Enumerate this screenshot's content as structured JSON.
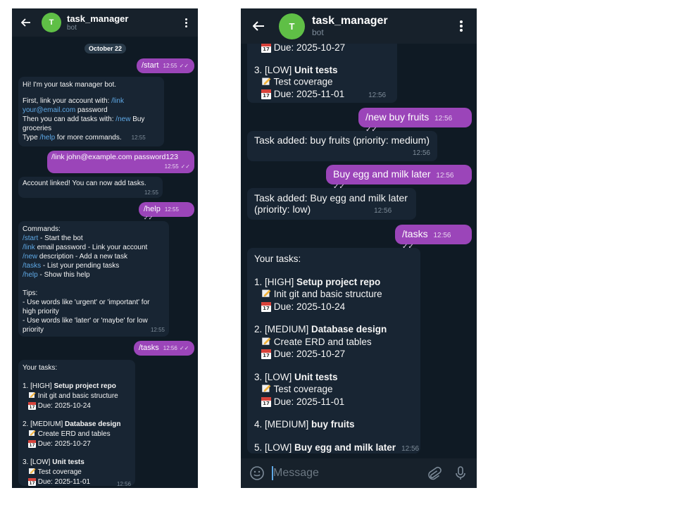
{
  "chat": {
    "title": "task_manager",
    "subtitle": "bot",
    "avatar_letter": "T",
    "date_pill": "October 22",
    "input_placeholder": "Message"
  },
  "messages": {
    "start": {
      "text": "/start",
      "time": "12:55"
    },
    "welcome": {
      "l1": "Hi! I'm your task manager bot.",
      "l2a": "First, link your account with: ",
      "l2b": "/link",
      "l3a": "your@email.com",
      "l3b": " password",
      "l4a": "Then you can add tasks with: ",
      "l4b": "/new",
      "l4c": " Buy",
      "l5": "groceries",
      "l6a": "Type ",
      "l6b": "/help",
      "l6c": " for more commands.",
      "time": "12:55"
    },
    "link": {
      "text": "/link john@example.com password123",
      "time": "12:55"
    },
    "linked": {
      "text": "Account linked! You can now add tasks.",
      "time": "12:55"
    },
    "help": {
      "text": "/help",
      "time": "12:55"
    },
    "commands": {
      "head": "Commands:",
      "c1a": "/start",
      "c1b": " - Start the bot",
      "c2a": "/link",
      "c2b": " email password - Link your account",
      "c3a": "/new",
      "c3b": " description - Add a new task",
      "c4a": "/tasks",
      "c4b": " - List your pending tasks",
      "c5a": "/help",
      "c5b": " - Show this help",
      "tips": "Tips:",
      "t1": "- Use words like 'urgent' or 'important' for",
      "t2": "high priority",
      "t3": "- Use words like 'later' or 'maybe' for low",
      "t4": "priority",
      "time": "12:55"
    },
    "tasks_cmd1": {
      "text": "/tasks",
      "time": "12:56"
    },
    "tasks_list1": {
      "head": "Your tasks:",
      "i1a": "1. [HIGH] ",
      "i1b": "Setup project repo",
      "i1c": "Init git and basic structure",
      "i1d": "Due: 2025-10-24",
      "i2a": "2. [MEDIUM] ",
      "i2b": "Database design",
      "i2c": "Create ERD and tables",
      "i2d": "Due: 2025-10-27",
      "i3a": "3. [LOW] ",
      "i3b": "Unit tests",
      "i3c": "Test coverage",
      "i3d": "Due: 2025-11-01",
      "time": "12:56"
    },
    "partial": {
      "due": "Due: 2025-10-27",
      "i3a": "3. [LOW] ",
      "i3b": "Unit tests",
      "i3c": "Test coverage",
      "i3d": "Due: 2025-11-01",
      "time": "12:56"
    },
    "new_fruits": {
      "text": "/new buy fruits",
      "time": "12:56"
    },
    "added_fruits": {
      "text": "Task added: buy fruits (priority: medium)",
      "time": "12:56"
    },
    "egg": {
      "text": "Buy egg and milk later",
      "time": "12:56"
    },
    "added_egg": {
      "l1": "Task added: Buy egg and milk later",
      "l2": "(priority: low)",
      "time": "12:56"
    },
    "tasks_cmd2": {
      "text": "/tasks",
      "time": "12:56"
    },
    "tasks_list2": {
      "head": "Your tasks:",
      "i1a": "1. [HIGH] ",
      "i1b": "Setup project repo",
      "i1c": "Init git and basic structure",
      "i1d": "Due: 2025-10-24",
      "i2a": "2. [MEDIUM] ",
      "i2b": "Database design",
      "i2c": "Create ERD and tables",
      "i2d": "Due: 2025-10-27",
      "i3a": "3. [LOW] ",
      "i3b": "Unit tests",
      "i3c": "Test coverage",
      "i3d": "Due: 2025-11-01",
      "i4a": "4. [MEDIUM] ",
      "i4b": "buy fruits",
      "i5a": "5. [LOW] ",
      "i5b": "Buy egg and milk later",
      "time": "12:56"
    }
  },
  "calendar_day": "17",
  "icons": [
    "back-arrow-icon",
    "more-vert-icon",
    "double-check-icon",
    "pencil-memo-icon",
    "calendar-icon",
    "emoji-icon",
    "attach-icon",
    "mic-icon"
  ],
  "colors": {
    "header": "#17212b",
    "chat_bg": "#0e1621",
    "incoming": "#182533",
    "outgoing": "#9b45b9",
    "link": "#5fa9e6",
    "avatar": "#5fbf46"
  }
}
